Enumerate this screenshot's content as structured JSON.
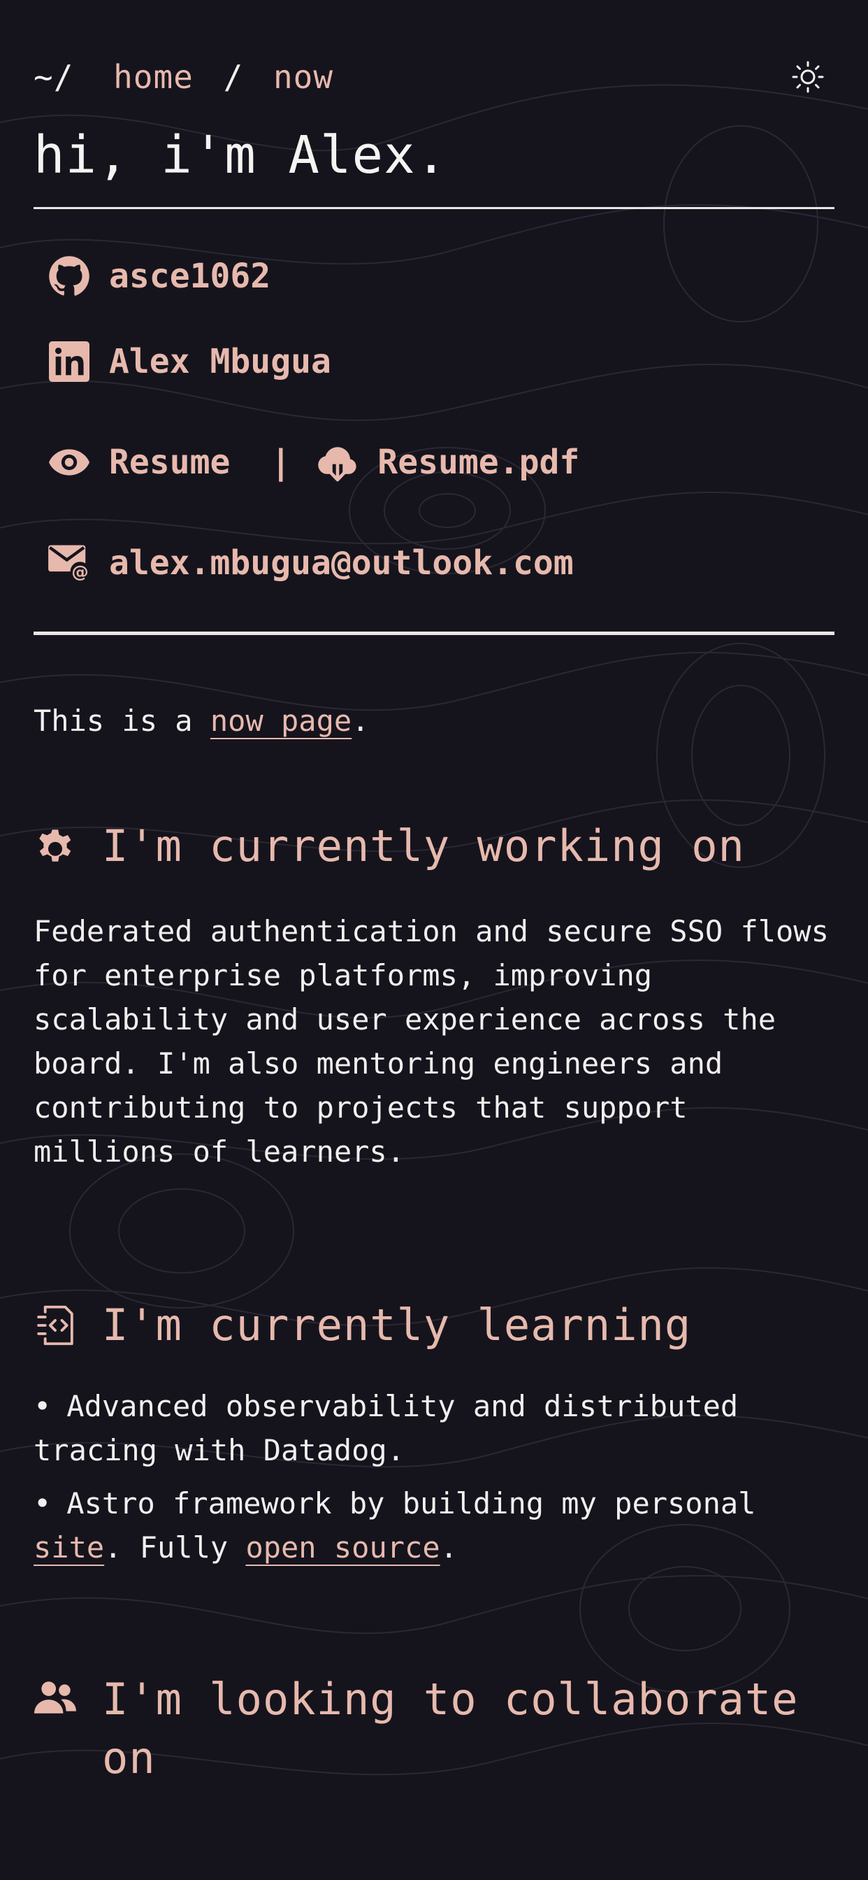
{
  "nav": {
    "prefix": "~/",
    "home": "home",
    "separator": "/",
    "current": "now",
    "theme_icon": "sun-icon"
  },
  "hero": {
    "title": "hi, i'm Alex."
  },
  "links": {
    "github": {
      "icon": "github-icon",
      "label": "asce1062"
    },
    "linkedin": {
      "icon": "linkedin-icon",
      "label": "Alex Mbugua"
    },
    "resume": {
      "icon": "eye-icon",
      "label": "Resume"
    },
    "divider": "|",
    "resume_pdf": {
      "icon": "cloud-download-icon",
      "label": "Resume.pdf"
    },
    "email": {
      "icon": "mail-icon",
      "label": "alex.mbugua@outlook.com"
    }
  },
  "intro": {
    "before": "This is a ",
    "link": "now page",
    "after": "."
  },
  "working": {
    "icon": "gear-icon",
    "title": "I'm currently working on",
    "text": "Federated authentication and secure SSO flows for enterprise platforms, improving scalability and user experience across the board. I'm also mentoring engineers and contributing to projects that support millions of learners."
  },
  "learning": {
    "icon": "code-file-icon",
    "title": "I'm currently learning",
    "bullet": "•",
    "item1": "Advanced observability and distributed tracing with Datadog.",
    "item2_before": "Astro framework by building my personal ",
    "item2_link1": "site",
    "item2_middle": ". Fully ",
    "item2_link2": "open source",
    "item2_after": "."
  },
  "collab": {
    "icon": "users-icon",
    "title": "I'm looking to collaborate on"
  },
  "colors": {
    "background": "#15141d",
    "accent": "#e7b9ad",
    "text": "#f2efee"
  }
}
